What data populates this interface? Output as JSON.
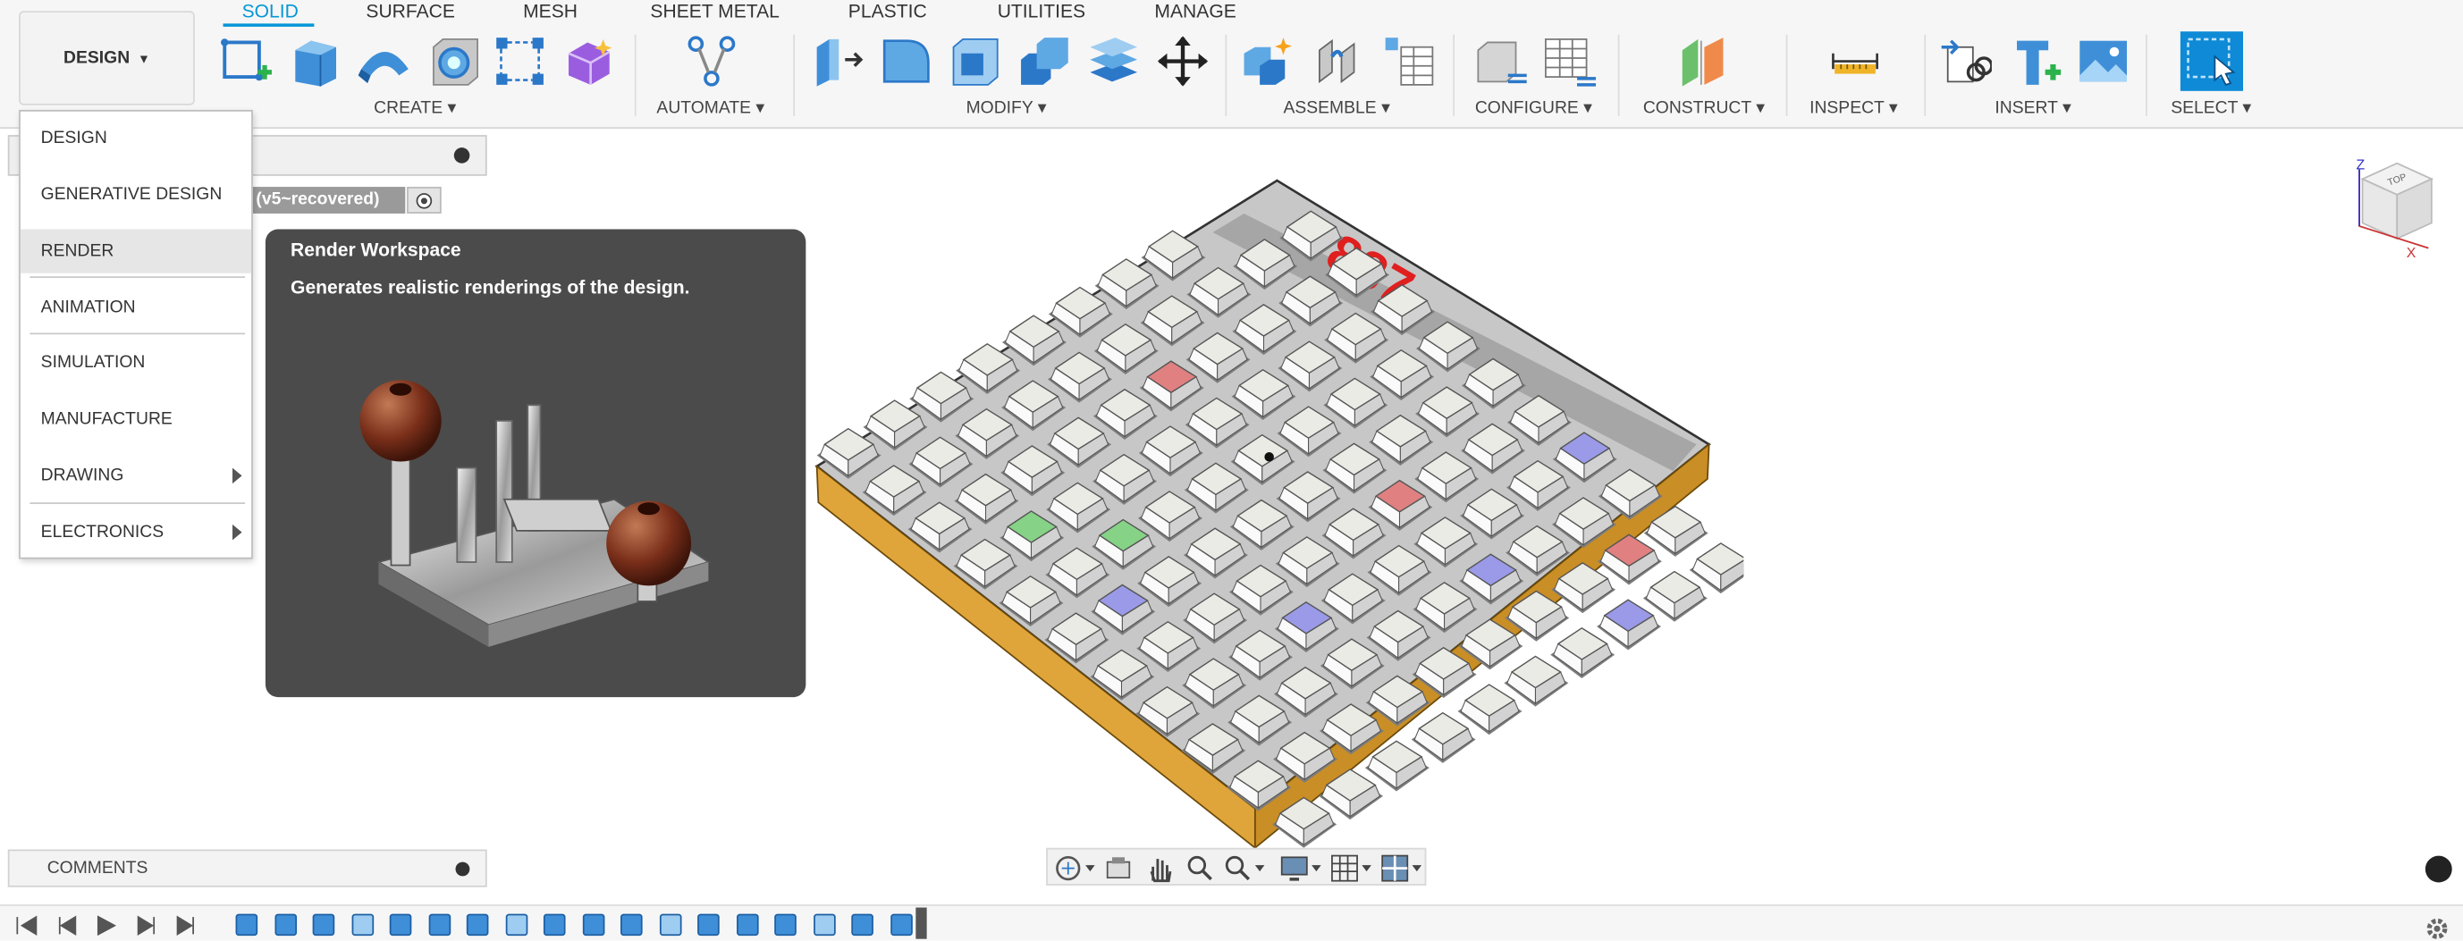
{
  "workspace_button": {
    "label": "DESIGN"
  },
  "tabs": [
    {
      "label": "SOLID",
      "active": true
    },
    {
      "label": "SURFACE"
    },
    {
      "label": "MESH"
    },
    {
      "label": "SHEET METAL"
    },
    {
      "label": "PLASTIC"
    },
    {
      "label": "UTILITIES"
    },
    {
      "label": "MANAGE"
    }
  ],
  "groups": [
    "CREATE",
    "AUTOMATE",
    "MODIFY",
    "ASSEMBLE",
    "CONFIGURE",
    "CONSTRUCT",
    "INSPECT",
    "INSERT",
    "SELECT"
  ],
  "workspace_menu": [
    {
      "label": "DESIGN"
    },
    {
      "label": "GENERATIVE DESIGN"
    },
    {
      "label": "RENDER",
      "highlighted": true
    },
    {
      "label": "ANIMATION"
    },
    {
      "label": "SIMULATION"
    },
    {
      "label": "MANUFACTURE"
    },
    {
      "label": "DRAWING",
      "submenu": true
    },
    {
      "label": "ELECTRONICS",
      "submenu": true
    }
  ],
  "tooltip": {
    "title": "Render Workspace",
    "description": "Generates realistic renderings of the design."
  },
  "document": {
    "version_label": "(v5~recovered)"
  },
  "comments": {
    "label": "COMMENTS"
  },
  "model": {
    "display_text": "887"
  },
  "viewcube": {
    "face_label": "TOP",
    "axes": [
      "Z",
      "X"
    ]
  },
  "colors": {
    "accent": "#0696d7",
    "tooltip_bg": "#4b4b4b",
    "frame": "#e0a53a",
    "key_red": "#e08080",
    "key_green": "#86d286",
    "key_blue": "#9a9ae8",
    "key_white": "#ebebe6",
    "display_red": "#e01f1f"
  },
  "icons": {
    "toolbar": [
      "create-sketch-icon",
      "extrude-icon",
      "revolve-icon",
      "hole-icon",
      "rectangular-pattern-icon",
      "create-form-icon",
      "automate-icon",
      "press-pull-icon",
      "fillet-icon",
      "shell-icon",
      "combine-icon",
      "replace-face-icon",
      "move-icon",
      "new-component-icon",
      "joint-icon",
      "bill-of-materials-icon",
      "configure-icon",
      "configure-table-icon",
      "construct-plane-icon",
      "measure-icon",
      "insert-derive-icon",
      "insert-mcmaster-icon",
      "insert-image-icon",
      "select-icon"
    ],
    "navbar": [
      "orbit-icon",
      "look-at-icon",
      "pan-icon",
      "zoom-icon",
      "zoom-window-icon",
      "display-settings-icon",
      "grid-settings-icon",
      "viewports-icon"
    ],
    "timeline": [
      "timeline-start-icon",
      "timeline-prev-icon",
      "timeline-play-icon",
      "timeline-next-icon",
      "timeline-end-icon"
    ]
  }
}
